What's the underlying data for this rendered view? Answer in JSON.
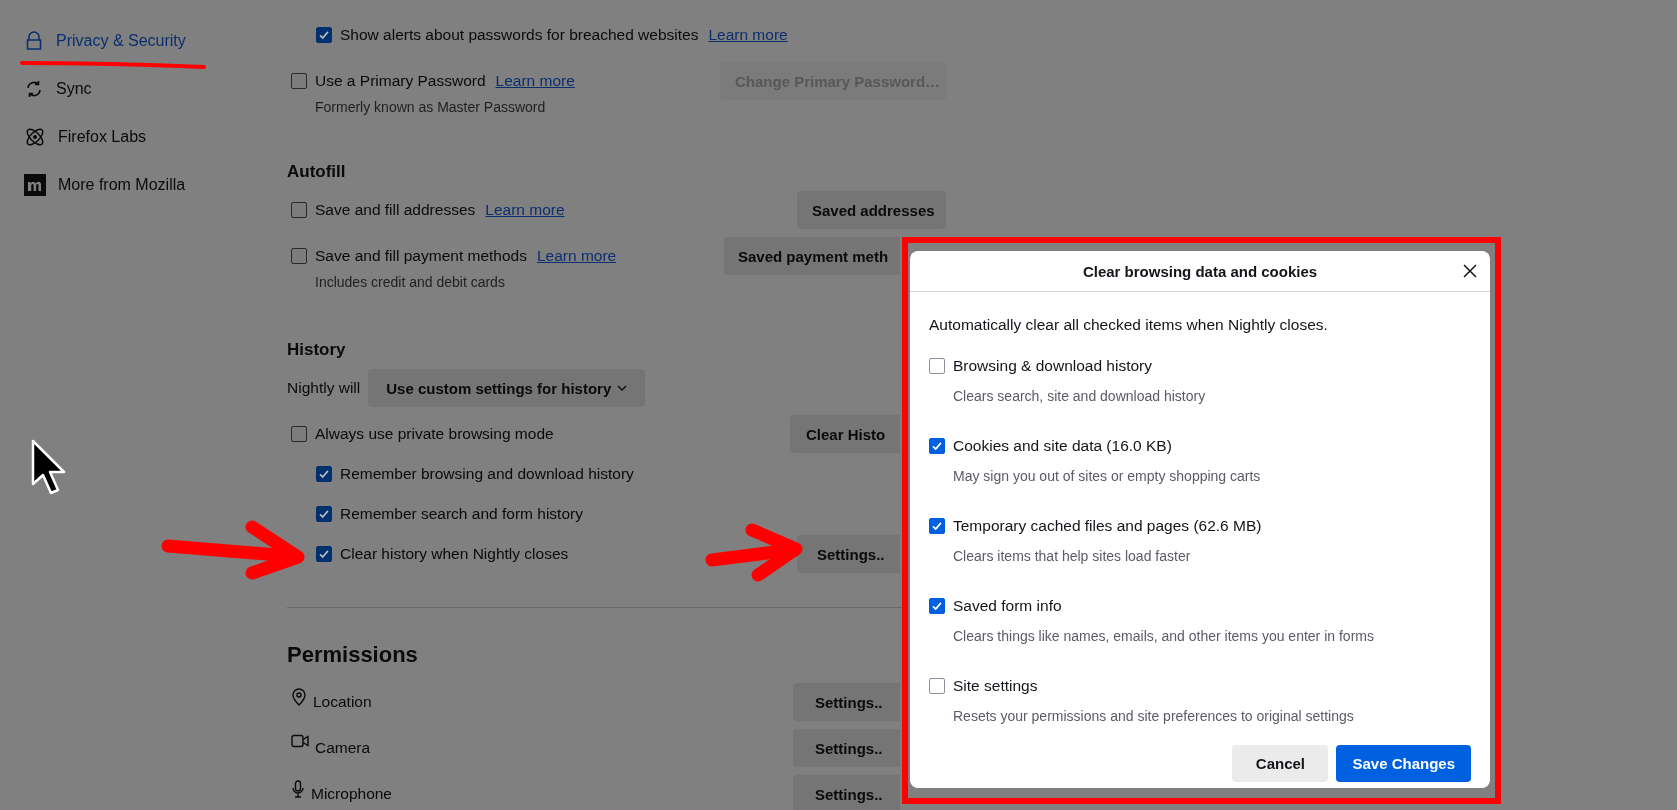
{
  "sidebar": {
    "items": [
      {
        "label": "Privacy & Security",
        "selected": true
      },
      {
        "label": "Sync",
        "selected": false
      },
      {
        "label": "Firefox Labs",
        "selected": false
      },
      {
        "label": "More from Mozilla",
        "selected": false
      }
    ]
  },
  "passwords": {
    "sub_rows": [
      {
        "label": "Show alerts about passwords for breached websites",
        "checked": true,
        "link": "Learn more"
      }
    ],
    "rows": [
      {
        "label": "Use a Primary Password",
        "checked": false,
        "link": "Learn more",
        "button": {
          "label": "Change Primary Password…",
          "disabled": true
        },
        "note": "Formerly known as Master Password"
      }
    ]
  },
  "autofill": {
    "heading": "Autofill",
    "rows": [
      {
        "label": "Save and fill addresses",
        "checked": false,
        "link": "Learn more",
        "button": {
          "label": "Saved addresses",
          "disabled": false
        }
      },
      {
        "label": "Save and fill payment methods",
        "checked": false,
        "link": "Learn more",
        "button": {
          "label": "Saved payment meth",
          "disabled": false
        },
        "note": "Includes credit and debit cards"
      }
    ]
  },
  "history": {
    "heading": "History",
    "mode_label": "Nightly will",
    "mode_value": "Use custom settings for history",
    "rows": [
      {
        "label": "Always use private browsing mode",
        "checked": false,
        "button": {
          "label": "Clear Histo",
          "disabled": false
        },
        "children": [
          {
            "label": "Remember browsing and download history",
            "checked": true
          },
          {
            "label": "Remember search and form history",
            "checked": true
          },
          {
            "label": "Clear history when Nightly closes",
            "checked": true,
            "button": {
              "label": "Settings..",
              "disabled": false
            }
          }
        ]
      }
    ]
  },
  "permissions": {
    "heading": "Permissions",
    "rows": [
      {
        "label": "Location",
        "button": {
          "label": "Settings..",
          "disabled": false
        }
      },
      {
        "label": "Camera",
        "button": {
          "label": "Settings..",
          "disabled": false
        }
      },
      {
        "label": "Microphone",
        "button": {
          "label": "Settings..",
          "disabled": false
        }
      }
    ]
  },
  "dialog": {
    "title": "Clear browsing data and cookies",
    "intro": "Automatically clear all checked items when Nightly closes.",
    "options": [
      {
        "label": "Browsing & download history",
        "checked": false,
        "description": "Clears search, site and download history"
      },
      {
        "label": "Cookies and site data (16.0 KB)",
        "checked": true,
        "description": "May sign you out of sites or empty shopping carts"
      },
      {
        "label": "Temporary cached files and pages (62.6 MB)",
        "checked": true,
        "description": "Clears items that help sites load faster"
      },
      {
        "label": "Saved form info",
        "checked": true,
        "description": "Clears things like names, emails, and other items you enter in forms"
      },
      {
        "label": "Site settings",
        "checked": false,
        "description": "Resets your permissions and site preferences to original settings"
      }
    ],
    "buttons": [
      {
        "label": "Cancel",
        "kind": "secondary"
      },
      {
        "label": "Save Changes",
        "kind": "primary"
      }
    ]
  }
}
